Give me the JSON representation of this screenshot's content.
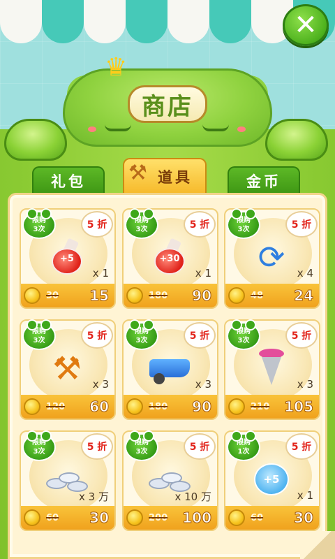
{
  "header": {
    "title": "商店",
    "close_label": "✕"
  },
  "tabs": [
    {
      "label": "礼包",
      "active": false
    },
    {
      "label": "道具",
      "active": true
    },
    {
      "label": "金币",
      "active": false
    }
  ],
  "items": [
    {
      "limit_line1": "限购",
      "limit_line2": "3次",
      "discount": "5 折",
      "icon": "red-potion-plus5",
      "icon_text": "+5",
      "qty": "x 1",
      "old_price": "30",
      "new_price": "15"
    },
    {
      "limit_line1": "限购",
      "limit_line2": "3次",
      "discount": "5 折",
      "icon": "red-potion-plus30",
      "icon_text": "+30",
      "qty": "x 1",
      "old_price": "180",
      "new_price": "90"
    },
    {
      "limit_line1": "限购",
      "limit_line2": "3次",
      "discount": "5 折",
      "icon": "refresh-arrows-icon",
      "icon_text": "",
      "qty": "x 4",
      "old_price": "48",
      "new_price": "24"
    },
    {
      "limit_line1": "限购",
      "limit_line2": "3次",
      "discount": "5 折",
      "icon": "hammer-icon",
      "icon_text": "",
      "qty": "x 3",
      "old_price": "120",
      "new_price": "60"
    },
    {
      "limit_line1": "限购",
      "limit_line2": "3次",
      "discount": "5 折",
      "icon": "wheelbarrow-icon",
      "icon_text": "",
      "qty": "x 3",
      "old_price": "180",
      "new_price": "90"
    },
    {
      "limit_line1": "限购",
      "limit_line2": "3次",
      "discount": "5 折",
      "icon": "drill-icon",
      "icon_text": "",
      "qty": "x 3",
      "old_price": "210",
      "new_price": "105"
    },
    {
      "limit_line1": "限购",
      "limit_line2": "3次",
      "discount": "5 折",
      "icon": "silver-coins-icon",
      "icon_text": "",
      "qty": "x 3 万",
      "old_price": "60",
      "new_price": "30"
    },
    {
      "limit_line1": "限购",
      "limit_line2": "3次",
      "discount": "5 折",
      "icon": "silver-coins-pile-icon",
      "icon_text": "",
      "qty": "x 10 万",
      "old_price": "200",
      "new_price": "100"
    },
    {
      "limit_line1": "限购",
      "limit_line2": "1次",
      "discount": "5 折",
      "icon": "paw-plus5-icon",
      "icon_text": "+5",
      "qty": "x 1",
      "old_price": "60",
      "new_price": "30"
    }
  ]
}
